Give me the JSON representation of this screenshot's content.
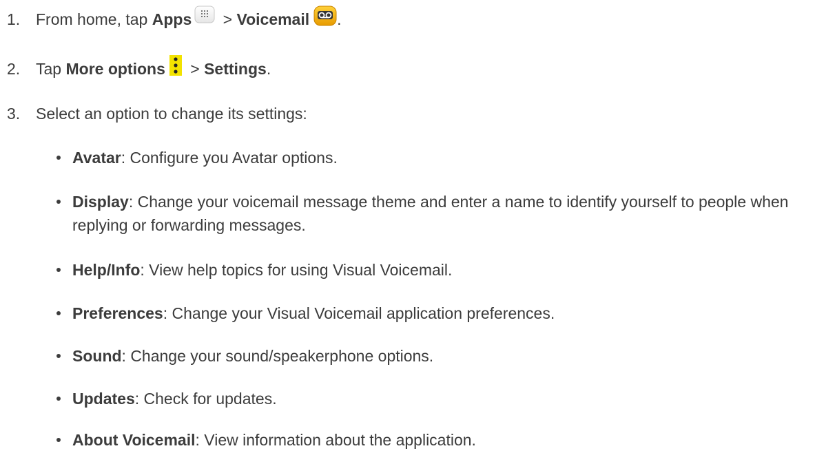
{
  "steps": [
    {
      "number": "1.",
      "pre": "From home, tap ",
      "b1": "Apps",
      "sep": " > ",
      "b2": "Voicemail",
      "post": ".",
      "icons": [
        "apps-grid-icon",
        "voicemail-app-icon"
      ]
    },
    {
      "number": "2.",
      "pre": "Tap ",
      "b1": "More options",
      "sep": " > ",
      "b2": "Settings",
      "post": ".",
      "icons": [
        "more-options-icon"
      ]
    },
    {
      "number": "3.",
      "text": "Select an option to change its settings:"
    }
  ],
  "options": [
    {
      "term": "Avatar",
      "desc": ": Configure you Avatar options."
    },
    {
      "term": "Display",
      "desc": ": Change your voicemail message theme and enter a name to identify yourself to people when replying or forwarding messages."
    },
    {
      "term": "Help/Info",
      "desc": ": View help topics for using Visual Voicemail."
    },
    {
      "term": "Preferences",
      "desc": ": Change your Visual Voicemail application preferences."
    },
    {
      "term": "Sound",
      "desc": ": Change your sound/speakerphone options."
    },
    {
      "term": "Updates",
      "desc": ": Check for updates."
    },
    {
      "term": "About Voicemail",
      "desc": ": View information about the application."
    }
  ],
  "colors": {
    "text": "#3c3c3c",
    "more_options_icon": "#f2e200",
    "voicemail_icon": "#f0a800"
  }
}
